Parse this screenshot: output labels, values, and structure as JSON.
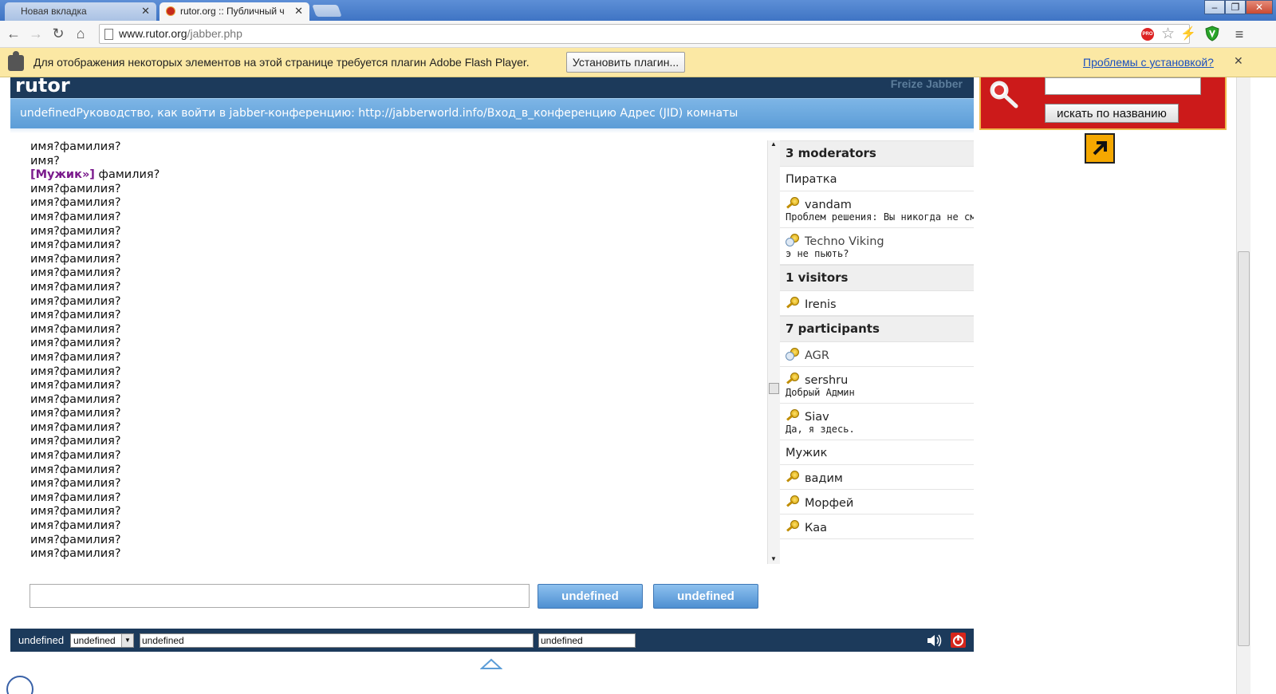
{
  "browser": {
    "tabs": [
      {
        "title": "Новая вкладка",
        "active": false
      },
      {
        "title": "rutor.org :: Публичный ч",
        "active": true
      }
    ],
    "url_host": "www.rutor.org",
    "url_path": "/jabber.php",
    "pro_badge": "PRO"
  },
  "infobar": {
    "message": "Для отображения некоторых элементов на этой странице требуется плагин Adobe Flash Player.",
    "install_label": "Установить плагин...",
    "help_link": "Проблемы с установкой?"
  },
  "site": {
    "logo": "rutor",
    "brand": "Freize Jabber",
    "topic": "undefinedРуководство, как войти в jabber-конференцию: http://jabberworld.info/Вход_в_конференцию Адрес (JID) комнаты"
  },
  "search": {
    "button_label": "искать по названию"
  },
  "messages": [
    {
      "text": "имя?фамилия?"
    },
    {
      "text": "имя?"
    },
    {
      "nick": "[Мужик»]",
      "text": " фамилия?"
    },
    {
      "text": "имя?фамилия?"
    },
    {
      "text": "имя?фамилия?"
    },
    {
      "text": "имя?фамилия?"
    },
    {
      "text": "имя?фамилия?"
    },
    {
      "text": "имя?фамилия?"
    },
    {
      "text": "имя?фамилия?"
    },
    {
      "text": "имя?фамилия?"
    },
    {
      "text": "имя?фамилия?"
    },
    {
      "text": "имя?фамилия?"
    },
    {
      "text": "имя?фамилия?"
    },
    {
      "text": "имя?фамилия?"
    },
    {
      "text": "имя?фамилия?"
    },
    {
      "text": "имя?фамилия?"
    },
    {
      "text": "имя?фамилия?"
    },
    {
      "text": "имя?фамилия?"
    },
    {
      "text": "имя?фамилия?"
    },
    {
      "text": "имя?фамилия?"
    },
    {
      "text": "имя?фамилия?"
    },
    {
      "text": "имя?фамилия?"
    },
    {
      "text": "имя?фамилия?"
    },
    {
      "text": "имя?фамилия?"
    },
    {
      "text": "имя?фамилия?"
    },
    {
      "text": "имя?фамилия?"
    },
    {
      "text": "имя?фамилия?"
    },
    {
      "text": "имя?фамилия?"
    },
    {
      "text": "имя?фамилия?"
    },
    {
      "text": "имя?фамилия?"
    }
  ],
  "roster": [
    {
      "group": "3 moderators",
      "members": [
        {
          "name": "Пиратка",
          "icon": "none"
        },
        {
          "name": "vandam",
          "icon": "key-icon",
          "status": "Проблем решения: Вы никогда не сможете решить проблему"
        },
        {
          "name": "Techno Viking",
          "icon": "key-away-icon",
          "status": "э не пьють?",
          "dim": true
        }
      ]
    },
    {
      "group": "1 visitors",
      "members": [
        {
          "name": "Irenis",
          "icon": "key-icon"
        }
      ]
    },
    {
      "group": "7 participants",
      "members": [
        {
          "name": "AGR",
          "icon": "key-away-icon",
          "dim": true
        },
        {
          "name": "sershru",
          "icon": "key-icon",
          "status": "Добрый Админ"
        },
        {
          "name": "Siav",
          "icon": "key-icon",
          "status": "Да, я здесь."
        },
        {
          "name": "Мужик",
          "icon": "none"
        },
        {
          "name": "вадим",
          "icon": "key-icon"
        },
        {
          "name": "Морфей",
          "icon": "key-icon"
        },
        {
          "name": "Каа",
          "icon": "key-icon"
        }
      ]
    }
  ],
  "compose": {
    "send_label": "undefined",
    "clear_label": "undefined"
  },
  "footer": {
    "label": "undefined",
    "select_value": "undefined",
    "nick_value": "undefined",
    "password_value": "undefined"
  }
}
